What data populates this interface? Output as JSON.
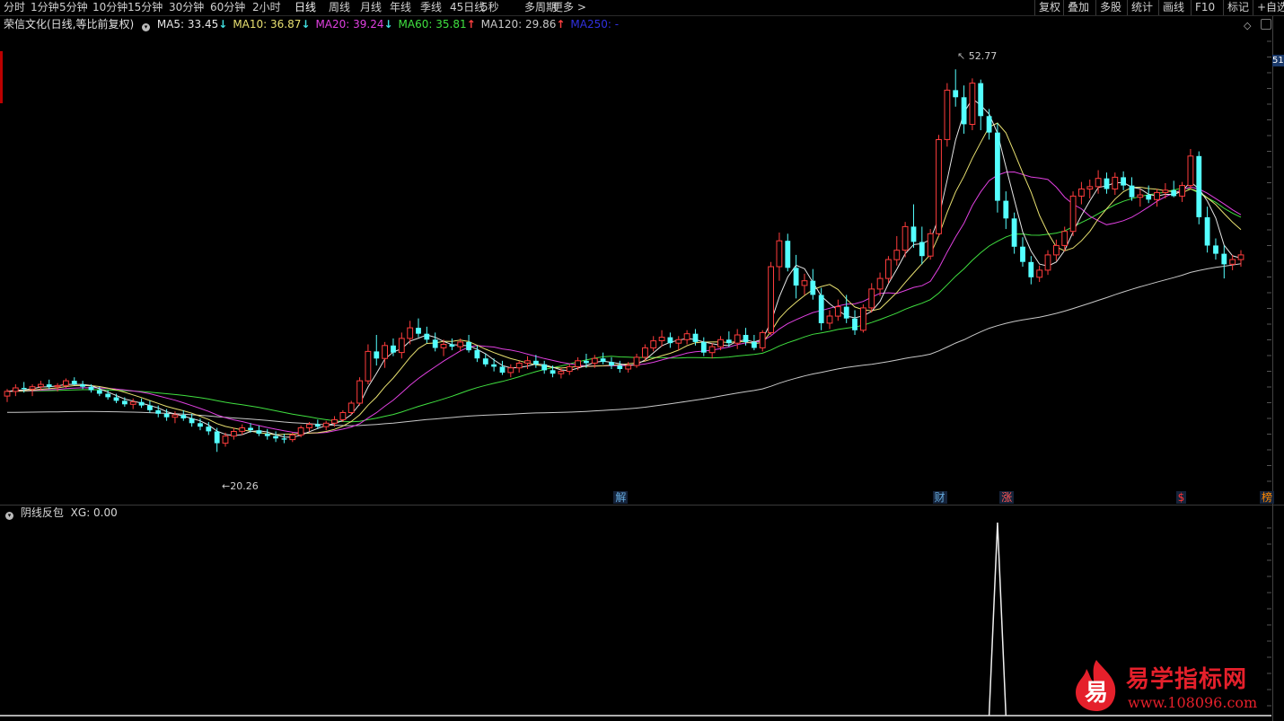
{
  "toolbar": {
    "periods": [
      "分时",
      "1分钟",
      "5分钟",
      "10分钟",
      "15分钟",
      "30分钟",
      "60分钟",
      "2小时",
      "日线",
      "周线",
      "月线",
      "年线",
      "季线",
      "45日线",
      "5秒",
      "多周期",
      "更多 >"
    ],
    "active_period": "日线",
    "right_buttons": [
      "复权",
      "叠加",
      "多股",
      "统计",
      "画线",
      "F10",
      "标记",
      "+自选"
    ]
  },
  "title_bar": {
    "stock": "荣信文化(日线,等比前复权)",
    "ma": [
      {
        "label": "MA5: 33.45",
        "arrow": "↓",
        "color": "#e6e6e6"
      },
      {
        "label": "MA10: 36.87",
        "arrow": "↓",
        "color": "#e8e070"
      },
      {
        "label": "MA20: 39.24",
        "arrow": "↓",
        "color": "#e040e0"
      },
      {
        "label": "MA60: 35.81",
        "arrow": "↑",
        "color": "#40e040"
      },
      {
        "label": "MA120: 29.86",
        "arrow": "↑",
        "color": "#c8c8c8"
      },
      {
        "label": "MA250: -",
        "arrow": "",
        "color": "#3030e0"
      }
    ],
    "arrow_colors": {
      "down": "#40e0e0",
      "up": "#ff4040"
    }
  },
  "annotations": {
    "low_label": "←20.26",
    "high_label": "52.77",
    "price_tag": "51"
  },
  "event_badges": [
    {
      "text": "解",
      "color": "#6ad",
      "x_index": 73
    },
    {
      "text": "财",
      "color": "#6ad",
      "x_index": 111
    },
    {
      "text": "涨",
      "color": "#f55",
      "x_index": 119
    },
    {
      "text": "$",
      "color": "#f33",
      "x_index": 140
    },
    {
      "text": "榜",
      "color": "#f80",
      "x_index": 150
    }
  ],
  "indicator": {
    "name": "阴线反包",
    "value_label": "XG: 0.00",
    "signal_index": 118
  },
  "watermark": {
    "logo_char": "易",
    "title": "易学指标网",
    "url": "www.108096.com"
  },
  "colors": {
    "up": "#ff3c3c",
    "down": "#54ffff",
    "ma5": "#e6e6e6",
    "ma10": "#e8e070",
    "ma20": "#e040e0",
    "ma60": "#40e040",
    "ma120": "#c8c8c8"
  },
  "chart_data": {
    "type": "candlestick",
    "period": "daily",
    "ylim": [
      17,
      55
    ],
    "candles": [
      [
        25.0,
        25.6,
        24.5,
        25.4
      ],
      [
        25.4,
        26.0,
        25.0,
        25.7
      ],
      [
        25.7,
        26.2,
        25.3,
        25.6
      ],
      [
        25.6,
        26.0,
        25.0,
        25.8
      ],
      [
        25.8,
        26.3,
        25.5,
        26.0
      ],
      [
        26.0,
        26.4,
        25.6,
        25.8
      ],
      [
        25.8,
        26.1,
        25.4,
        25.9
      ],
      [
        25.9,
        26.5,
        25.7,
        26.3
      ],
      [
        26.3,
        26.6,
        25.9,
        26.0
      ],
      [
        26.0,
        26.3,
        25.6,
        25.8
      ],
      [
        25.8,
        26.0,
        25.3,
        25.5
      ],
      [
        25.5,
        25.8,
        25.0,
        25.2
      ],
      [
        25.2,
        25.5,
        24.7,
        24.9
      ],
      [
        24.9,
        25.2,
        24.4,
        24.6
      ],
      [
        24.6,
        24.9,
        24.1,
        24.3
      ],
      [
        24.3,
        24.8,
        23.9,
        24.5
      ],
      [
        24.5,
        24.8,
        24.0,
        24.2
      ],
      [
        24.2,
        24.6,
        23.6,
        23.8
      ],
      [
        23.8,
        24.2,
        23.2,
        23.5
      ],
      [
        23.5,
        23.9,
        22.9,
        23.2
      ],
      [
        23.2,
        23.7,
        22.7,
        23.4
      ],
      [
        23.4,
        23.8,
        22.9,
        23.1
      ],
      [
        23.1,
        23.5,
        22.4,
        22.7
      ],
      [
        22.7,
        23.1,
        22.1,
        22.4
      ],
      [
        22.4,
        22.8,
        21.7,
        22.0
      ],
      [
        22.0,
        22.3,
        20.26,
        21.0
      ],
      [
        21.0,
        21.9,
        20.7,
        21.6
      ],
      [
        21.6,
        22.3,
        21.3,
        22.0
      ],
      [
        22.0,
        22.6,
        21.7,
        22.3
      ],
      [
        22.3,
        22.7,
        21.9,
        22.1
      ],
      [
        22.1,
        22.5,
        21.6,
        21.8
      ],
      [
        21.8,
        22.2,
        21.3,
        21.6
      ],
      [
        21.6,
        22.0,
        21.1,
        21.4
      ],
      [
        21.4,
        21.8,
        21.0,
        21.3
      ],
      [
        21.3,
        21.9,
        21.1,
        21.7
      ],
      [
        21.7,
        22.5,
        21.5,
        22.3
      ],
      [
        22.3,
        22.8,
        22.0,
        22.6
      ],
      [
        22.6,
        23.0,
        22.2,
        22.4
      ],
      [
        22.4,
        22.9,
        22.1,
        22.7
      ],
      [
        22.7,
        23.3,
        22.4,
        23.0
      ],
      [
        23.0,
        23.8,
        22.8,
        23.6
      ],
      [
        23.6,
        24.6,
        23.4,
        24.4
      ],
      [
        24.4,
        26.6,
        24.2,
        26.3
      ],
      [
        26.3,
        29.4,
        26.0,
        28.8
      ],
      [
        28.8,
        30.2,
        27.6,
        28.2
      ],
      [
        28.2,
        29.6,
        27.4,
        29.3
      ],
      [
        29.3,
        29.9,
        28.4,
        28.7
      ],
      [
        28.7,
        30.4,
        28.2,
        29.9
      ],
      [
        29.9,
        31.4,
        29.4,
        30.8
      ],
      [
        30.8,
        31.6,
        30.0,
        30.3
      ],
      [
        30.3,
        30.9,
        29.5,
        29.8
      ],
      [
        29.8,
        30.4,
        28.8,
        29.1
      ],
      [
        29.1,
        29.8,
        28.4,
        29.4
      ],
      [
        29.4,
        29.9,
        28.9,
        29.2
      ],
      [
        29.2,
        29.9,
        28.8,
        29.6
      ],
      [
        29.6,
        30.2,
        28.7,
        28.9
      ],
      [
        28.9,
        29.3,
        27.9,
        28.2
      ],
      [
        28.2,
        28.6,
        27.5,
        27.7
      ],
      [
        27.7,
        28.2,
        27.1,
        27.5
      ],
      [
        27.5,
        28.0,
        26.8,
        27.0
      ],
      [
        27.0,
        27.7,
        26.6,
        27.4
      ],
      [
        27.4,
        28.0,
        27.0,
        27.8
      ],
      [
        27.8,
        28.4,
        27.3,
        28.0
      ],
      [
        28.0,
        28.5,
        27.4,
        27.7
      ],
      [
        27.7,
        28.0,
        26.9,
        27.2
      ],
      [
        27.2,
        27.6,
        26.6,
        26.9
      ],
      [
        26.9,
        27.4,
        26.5,
        27.1
      ],
      [
        27.1,
        27.7,
        26.8,
        27.5
      ],
      [
        27.5,
        28.3,
        27.2,
        28.0
      ],
      [
        28.0,
        28.6,
        27.4,
        27.8
      ],
      [
        27.8,
        28.5,
        27.4,
        28.2
      ],
      [
        28.2,
        28.7,
        27.7,
        27.9
      ],
      [
        27.9,
        28.3,
        27.3,
        27.6
      ],
      [
        27.6,
        28.0,
        27.0,
        27.3
      ],
      [
        27.3,
        27.9,
        27.0,
        27.6
      ],
      [
        27.6,
        28.6,
        27.4,
        28.3
      ],
      [
        28.3,
        29.4,
        28.0,
        29.1
      ],
      [
        29.1,
        30.1,
        28.8,
        29.7
      ],
      [
        29.7,
        30.6,
        29.2,
        30.0
      ],
      [
        30.0,
        30.4,
        29.1,
        29.5
      ],
      [
        29.5,
        30.1,
        28.9,
        29.8
      ],
      [
        29.8,
        30.6,
        29.4,
        30.3
      ],
      [
        30.3,
        30.7,
        29.3,
        29.6
      ],
      [
        29.6,
        30.0,
        28.4,
        28.7
      ],
      [
        28.7,
        29.5,
        28.2,
        29.2
      ],
      [
        29.2,
        30.1,
        28.9,
        29.8
      ],
      [
        29.8,
        30.5,
        29.2,
        29.5
      ],
      [
        29.5,
        30.7,
        29.0,
        30.2
      ],
      [
        30.2,
        30.8,
        29.3,
        29.6
      ],
      [
        29.6,
        30.2,
        28.9,
        29.1
      ],
      [
        29.1,
        30.6,
        28.8,
        30.4
      ],
      [
        30.4,
        36.4,
        30.2,
        36.0
      ],
      [
        36.0,
        38.9,
        34.8,
        38.2
      ],
      [
        38.2,
        38.8,
        35.6,
        35.9
      ],
      [
        35.9,
        37.0,
        33.3,
        34.4
      ],
      [
        34.4,
        35.4,
        33.6,
        34.8
      ],
      [
        34.8,
        35.8,
        33.2,
        33.6
      ],
      [
        33.6,
        34.2,
        30.6,
        31.2
      ],
      [
        31.2,
        32.3,
        30.7,
        31.8
      ],
      [
        31.8,
        33.2,
        31.4,
        32.6
      ],
      [
        32.6,
        33.6,
        31.2,
        31.6
      ],
      [
        31.6,
        32.3,
        30.2,
        30.6
      ],
      [
        30.6,
        32.8,
        30.4,
        32.5
      ],
      [
        32.5,
        34.6,
        32.1,
        34.1
      ],
      [
        34.1,
        35.5,
        33.5,
        35.0
      ],
      [
        35.0,
        36.9,
        34.6,
        36.6
      ],
      [
        36.6,
        38.6,
        36.1,
        37.4
      ],
      [
        37.4,
        39.8,
        36.8,
        39.4
      ],
      [
        39.4,
        41.3,
        37.6,
        38.1
      ],
      [
        38.1,
        39.4,
        36.2,
        36.9
      ],
      [
        36.9,
        39.2,
        36.6,
        38.8
      ],
      [
        38.8,
        47.2,
        38.6,
        46.8
      ],
      [
        46.8,
        51.6,
        46.2,
        51.0
      ],
      [
        51.0,
        52.77,
        49.6,
        50.4
      ],
      [
        50.4,
        51.4,
        47.3,
        48.1
      ],
      [
        48.1,
        52.0,
        47.6,
        51.6
      ],
      [
        51.6,
        51.9,
        47.6,
        48.8
      ],
      [
        48.8,
        49.4,
        46.8,
        47.4
      ],
      [
        47.4,
        48.2,
        40.6,
        41.6
      ],
      [
        41.6,
        42.4,
        39.2,
        40.1
      ],
      [
        40.1,
        40.6,
        37.1,
        37.7
      ],
      [
        37.7,
        38.5,
        36.0,
        36.4
      ],
      [
        36.4,
        36.9,
        34.5,
        35.1
      ],
      [
        35.1,
        36.1,
        34.7,
        35.7
      ],
      [
        35.7,
        37.4,
        35.3,
        37.0
      ],
      [
        37.0,
        38.3,
        36.5,
        37.8
      ],
      [
        37.8,
        39.4,
        37.3,
        39.0
      ],
      [
        39.0,
        42.4,
        38.6,
        42.0
      ],
      [
        42.0,
        43.2,
        41.3,
        42.6
      ],
      [
        42.6,
        43.4,
        41.8,
        42.8
      ],
      [
        42.8,
        44.2,
        42.2,
        43.5
      ],
      [
        43.5,
        44.0,
        42.2,
        42.6
      ],
      [
        42.6,
        44.0,
        42.1,
        43.6
      ],
      [
        43.6,
        44.1,
        42.5,
        42.9
      ],
      [
        42.9,
        43.6,
        41.6,
        41.9
      ],
      [
        41.9,
        42.6,
        41.1,
        42.1
      ],
      [
        42.1,
        42.9,
        41.4,
        41.7
      ],
      [
        41.7,
        42.6,
        41.1,
        42.3
      ],
      [
        42.3,
        43.1,
        41.8,
        42.5
      ],
      [
        42.5,
        43.3,
        41.9,
        42.0
      ],
      [
        42.0,
        43.2,
        41.5,
        42.9
      ],
      [
        42.9,
        46.0,
        42.6,
        45.4
      ],
      [
        45.4,
        45.8,
        39.6,
        40.2
      ],
      [
        40.2,
        41.1,
        37.2,
        37.8
      ],
      [
        37.8,
        38.4,
        36.6,
        37.1
      ],
      [
        37.1,
        37.8,
        35.0,
        36.2
      ],
      [
        36.2,
        37.0,
        35.7,
        36.6
      ],
      [
        36.6,
        37.4,
        36.0,
        37.0
      ]
    ]
  }
}
